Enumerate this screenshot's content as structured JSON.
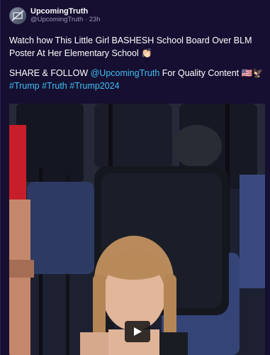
{
  "post": {
    "author_name": "UpcomingTruth",
    "author_handle": "@UpcomingTruth",
    "separator": "·",
    "time": "23h",
    "line1": "Watch how This Little Girl BASHESH School Board Over BLM Poster At Her Elementary School 👏🏻",
    "share_prefix": "SHARE & FOLLOW ",
    "share_mention": "@UpcomingTruth",
    "share_suffix": " For Quality Content 🇺🇸🦅",
    "hashtags": "#Trump #Truth #Trump2024"
  },
  "colors": {
    "background": "#160f31",
    "accent": "#3fc1f2",
    "muted": "#9b95b8"
  },
  "media": {
    "kind": "video",
    "play_icon": "play-icon"
  }
}
